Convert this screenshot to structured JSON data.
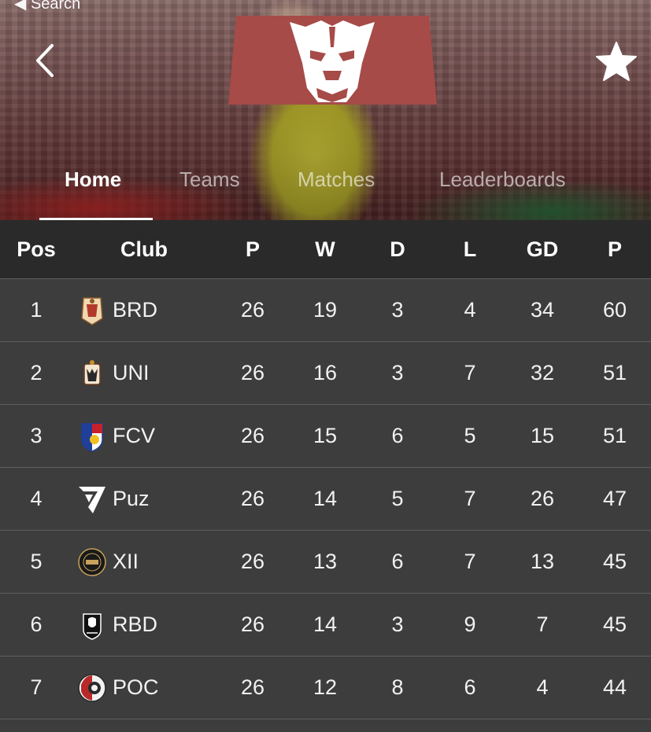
{
  "status_bar": {
    "back_label": "◀ Search"
  },
  "header": {
    "favorite_icon": "star-icon",
    "back_icon": "chevron-left-icon",
    "brand_color": "#a64b48"
  },
  "tabs": [
    {
      "label": "Home",
      "active": true
    },
    {
      "label": "Teams",
      "active": false
    },
    {
      "label": "Matches",
      "active": false
    },
    {
      "label": "Leaderboards",
      "active": false
    }
  ],
  "table": {
    "headers": [
      "Pos",
      "Club",
      "P",
      "W",
      "D",
      "L",
      "GD",
      "P"
    ],
    "rows": [
      {
        "pos": "1",
        "club": "BRD",
        "p": "26",
        "w": "19",
        "d": "3",
        "l": "4",
        "gd": "34",
        "pts": "60"
      },
      {
        "pos": "2",
        "club": "UNI",
        "p": "26",
        "w": "16",
        "d": "3",
        "l": "7",
        "gd": "32",
        "pts": "51"
      },
      {
        "pos": "3",
        "club": "FCV",
        "p": "26",
        "w": "15",
        "d": "6",
        "l": "5",
        "gd": "15",
        "pts": "51"
      },
      {
        "pos": "4",
        "club": "Puz",
        "p": "26",
        "w": "14",
        "d": "5",
        "l": "7",
        "gd": "26",
        "pts": "47"
      },
      {
        "pos": "5",
        "club": "XII",
        "p": "26",
        "w": "13",
        "d": "6",
        "l": "7",
        "gd": "13",
        "pts": "45"
      },
      {
        "pos": "6",
        "club": "RBD",
        "p": "26",
        "w": "14",
        "d": "3",
        "l": "9",
        "gd": "7",
        "pts": "45"
      },
      {
        "pos": "7",
        "club": "POC",
        "p": "26",
        "w": "12",
        "d": "8",
        "l": "6",
        "gd": "4",
        "pts": "44"
      }
    ]
  }
}
